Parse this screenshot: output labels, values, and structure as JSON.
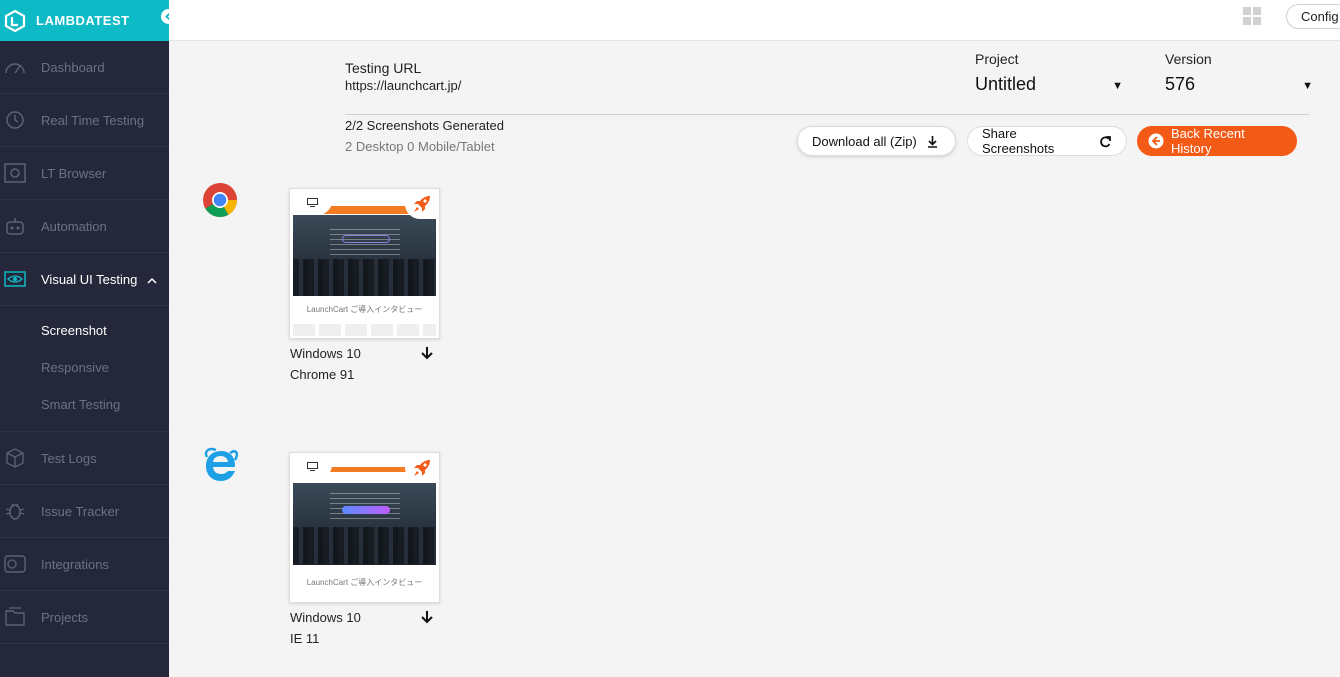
{
  "brand": {
    "name": "LAMBDATEST",
    "accent": "#0ebac5"
  },
  "sidebar": {
    "items": [
      {
        "label": "Dashboard",
        "icon": "dashboard-gauge-icon"
      },
      {
        "label": "Real Time Testing",
        "icon": "clock-icon"
      },
      {
        "label": "LT Browser",
        "icon": "lt-browser-icon"
      },
      {
        "label": "Automation",
        "icon": "robot-icon"
      },
      {
        "label": "Visual UI Testing",
        "icon": "eye-icon",
        "active": true
      },
      {
        "label": "Test Logs",
        "icon": "cube-icon"
      },
      {
        "label": "Issue Tracker",
        "icon": "bug-icon"
      },
      {
        "label": "Integrations",
        "icon": "integrations-icon"
      },
      {
        "label": "Projects",
        "icon": "folder-icon"
      }
    ],
    "sub_items": [
      {
        "label": "Screenshot",
        "active": true
      },
      {
        "label": "Responsive"
      },
      {
        "label": "Smart Testing"
      }
    ]
  },
  "topbar": {
    "config_label": "Config"
  },
  "header": {
    "testing_url_label": "Testing URL",
    "testing_url": "https://launchcart.jp/",
    "project_label": "Project",
    "project_value": "Untitled",
    "version_label": "Version",
    "version_value": "576",
    "generated": "2/2 Screenshots Generated",
    "breakdown": "2 Desktop 0 Mobile/Tablet"
  },
  "actions": {
    "download_all": "Download all (Zip)",
    "share": "Share Screenshots",
    "back": "Back Recent History",
    "back_color": "#f35a16"
  },
  "screenshots": [
    {
      "browser_icon": "chrome-icon",
      "os": "Windows 10",
      "browser": "Chrome 91",
      "caption": "LaunchCart ご導入インタビュー"
    },
    {
      "browser_icon": "internet-explorer-icon",
      "os": "Windows 10",
      "browser": "IE 11",
      "caption": "LaunchCart ご導入インタビュー"
    }
  ]
}
